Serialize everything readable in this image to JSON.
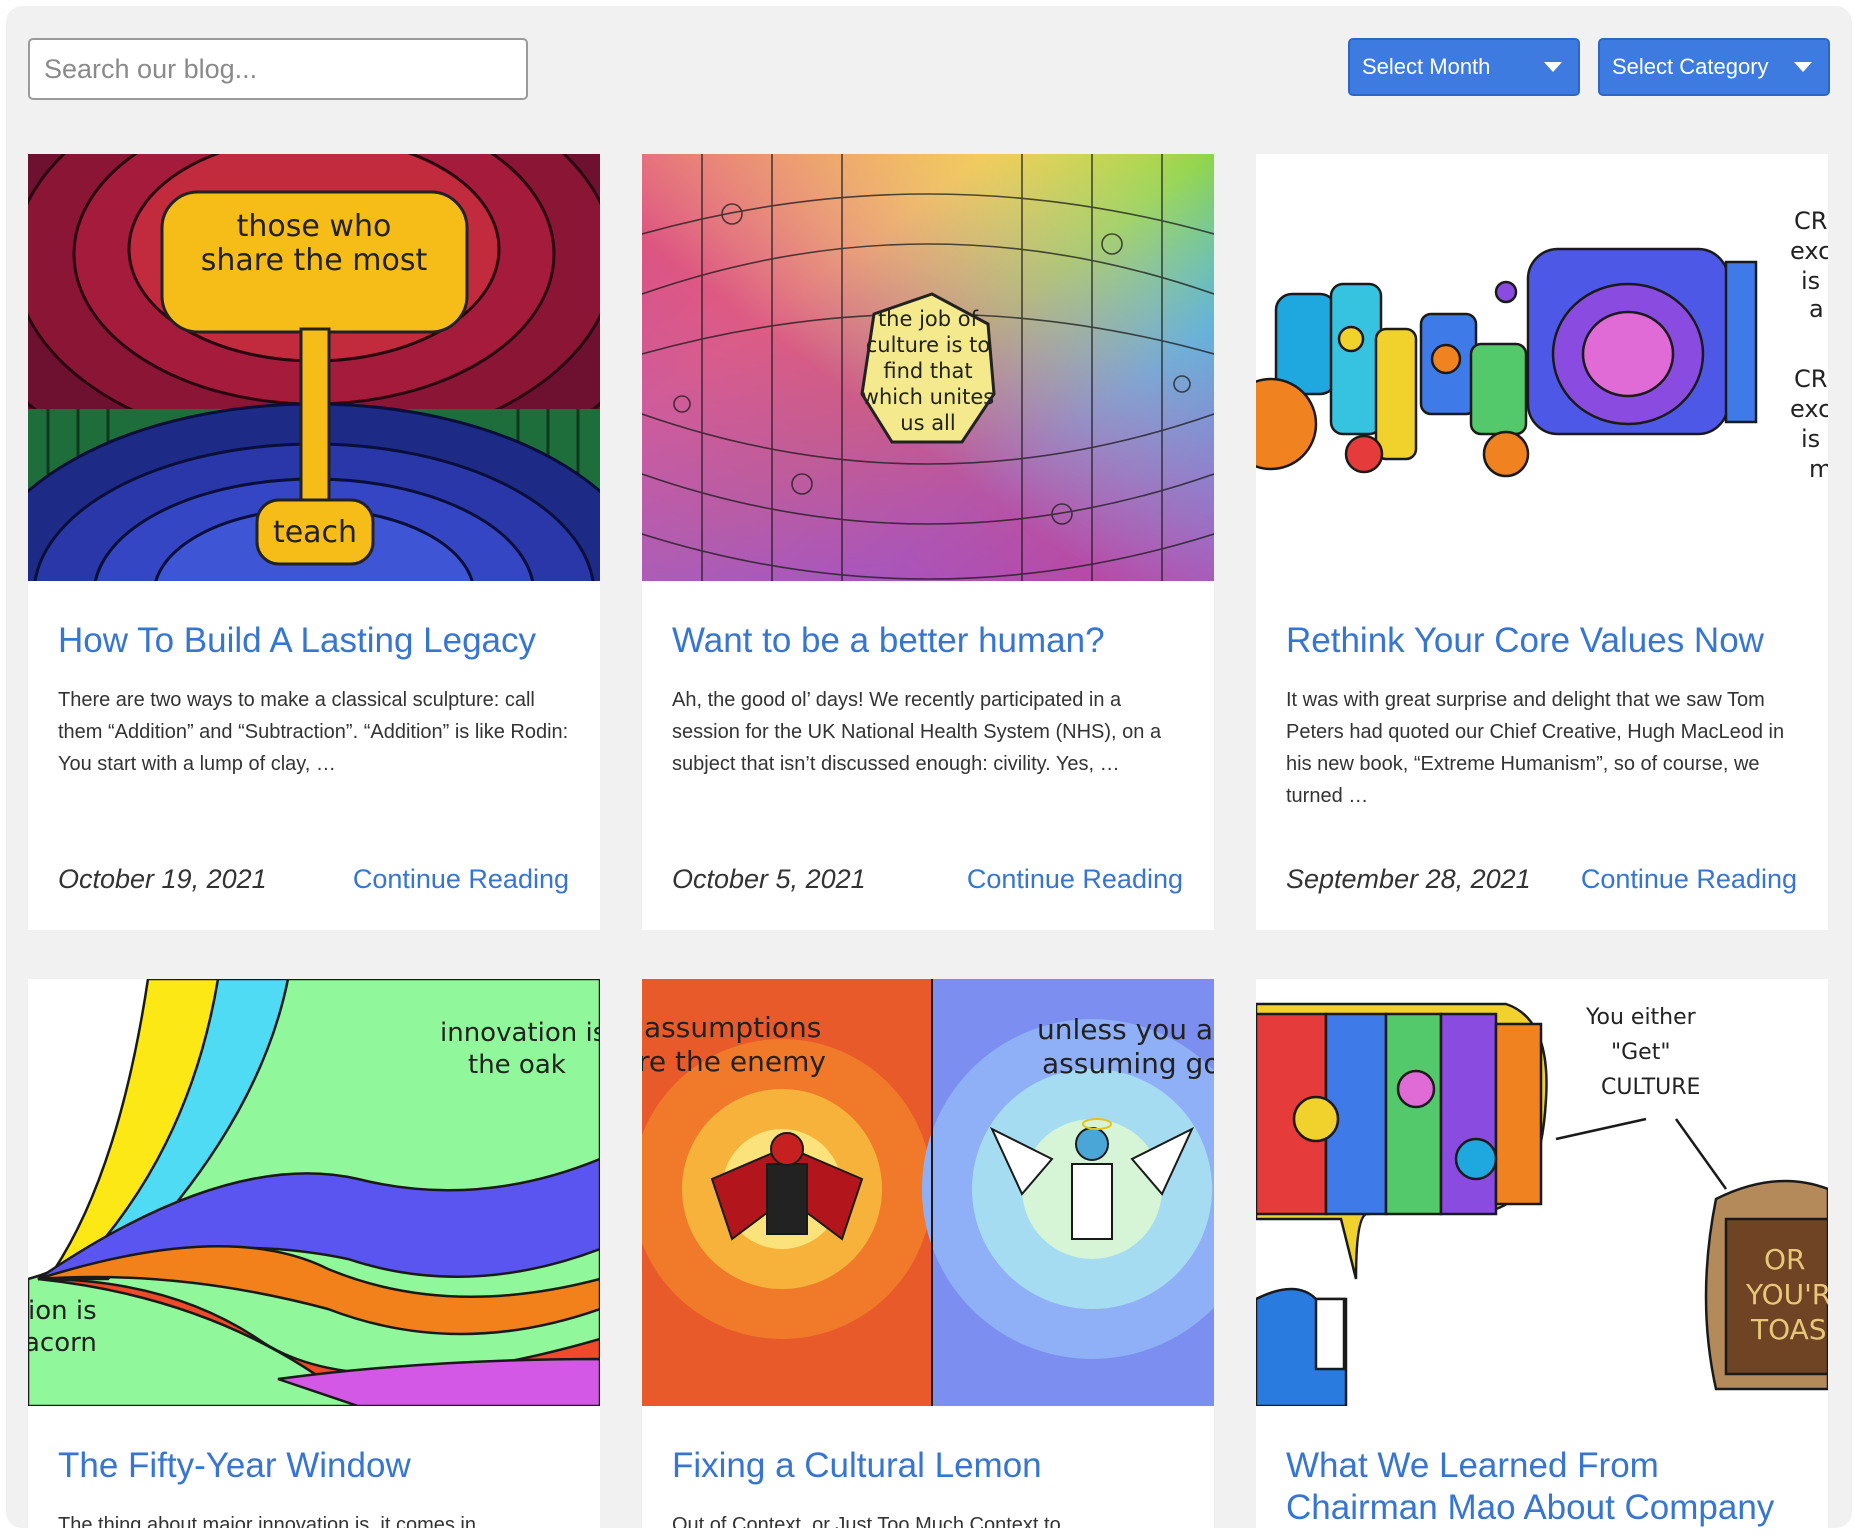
{
  "search": {
    "placeholder": "Search our blog..."
  },
  "filters": {
    "month_label": "Select Month",
    "category_label": "Select Category"
  },
  "posts": [
    {
      "title": "How To Build A Lasting Legacy",
      "excerpt": "There are two ways to make a classical sculpture: call them “Addition” and “Subtraction”. “Addition” is like Rodin: You start with a lump of clay, …",
      "date": "October 19, 2021",
      "more": "Continue Reading",
      "image_text": [
        "those who",
        "share the most",
        "teach"
      ]
    },
    {
      "title": "Want to be a better human?",
      "excerpt": "  Ah, the good ol’ days! We recently participated in a session for the UK National Health System (NHS), on a subject that isn’t discussed enough: civility. Yes, …",
      "date": "October 5, 2021",
      "more": "Continue Reading",
      "image_text": [
        "the job of",
        "culture is to",
        "find that",
        "which unites",
        "us all"
      ]
    },
    {
      "title": "Rethink Your Core Values Now",
      "excerpt": "  It was with great surprise and delight that we saw Tom Peters had quoted our Chief Creative, Hugh MacLeod in his new book, “Extreme Humanism”, so of course, we turned …",
      "date": "September 28, 2021",
      "more": "Continue Reading",
      "image_text": [
        "CRE",
        "exc",
        "is",
        "a",
        "CRE",
        "exc",
        "is",
        "m"
      ]
    },
    {
      "title": "The Fifty-Year Window",
      "excerpt": "  The thing about major innovation is, it comes in",
      "image_text": [
        "innovation is",
        "the oak",
        "ion is",
        "acorn"
      ]
    },
    {
      "title": "Fixing a Cultural Lemon",
      "excerpt": "  Out of Context, or Just Too Much Context to",
      "image_text": [
        "assumptions",
        "re the enemy",
        "unless you a",
        "assuming goo"
      ]
    },
    {
      "title": "What We Learned From Chairman Mao About Company",
      "excerpt": "",
      "image_text": [
        "You either",
        "\"Get\"",
        "CULTURE",
        "OR",
        "YOU'R",
        "TOAS"
      ]
    }
  ],
  "colors": {
    "accent": "#3675d2",
    "button": "#3d7be0",
    "background": "#f1f1f1"
  }
}
